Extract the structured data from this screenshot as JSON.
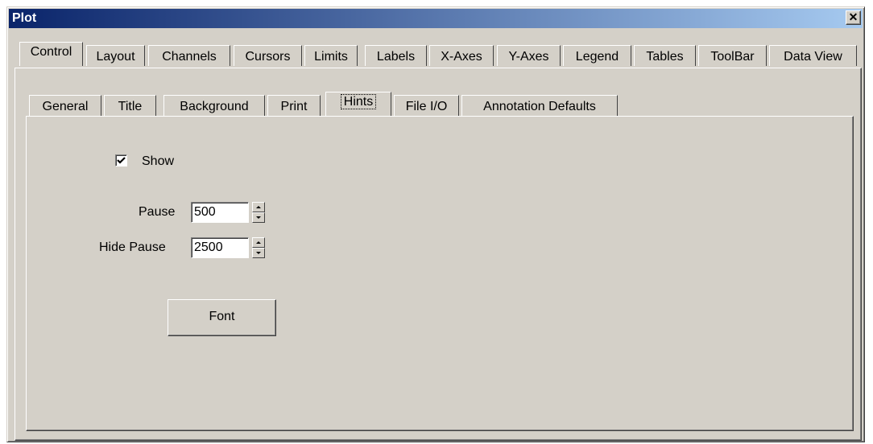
{
  "window": {
    "title": "Plot",
    "close_symbol": "✕"
  },
  "top_tabs": [
    "Control",
    "Layout",
    "Channels",
    "Cursors",
    "Limits",
    "Labels",
    "X-Axes",
    "Y-Axes",
    "Legend",
    "Tables",
    "ToolBar",
    "Data View"
  ],
  "top_active": "Control",
  "sub_tabs": [
    "General",
    "Title",
    "Background",
    "Print",
    "Hints",
    "File I/O",
    "Annotation Defaults"
  ],
  "sub_active": "Hints",
  "hints": {
    "show_label": "Show",
    "show_checked": true,
    "pause_label": "Pause",
    "pause_value": "500",
    "hide_pause_label": "Hide Pause",
    "hide_pause_value": "2500",
    "font_button": "Font"
  }
}
